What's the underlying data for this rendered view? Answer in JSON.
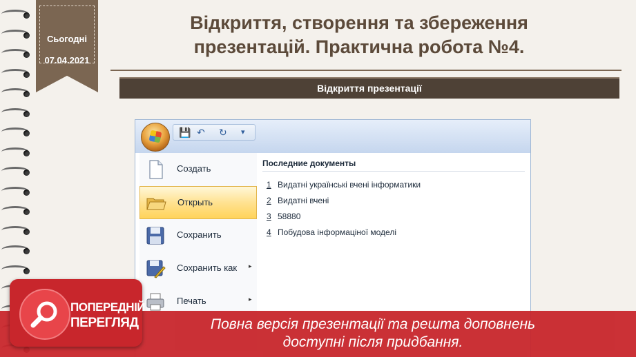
{
  "date_ribbon": {
    "label": "Сьогодні",
    "date": "07.04.2021"
  },
  "slide": {
    "title": "Відкриття, створення та збереження презентацій. Практична робота №4.",
    "section_heading": "Відкриття презентації"
  },
  "office_menu": {
    "items": [
      {
        "label": "Создать",
        "icon": "new-document-icon",
        "submenu": false,
        "active": false
      },
      {
        "label": "Открыть",
        "icon": "open-folder-icon",
        "submenu": false,
        "active": true
      },
      {
        "label": "Сохранить",
        "icon": "save-disk-icon",
        "submenu": false,
        "active": false
      },
      {
        "label": "Сохранить как",
        "icon": "save-as-icon",
        "submenu": true,
        "active": false
      },
      {
        "label": "Печать",
        "icon": "printer-icon",
        "submenu": true,
        "active": false
      }
    ],
    "submenu_arrow": "▸",
    "recent_title": "Последние документы",
    "recent": [
      {
        "num": "1",
        "name": "Видатні українські вчені інформатики"
      },
      {
        "num": "2",
        "name": "Видатні вчені"
      },
      {
        "num": "3",
        "name": "58880"
      },
      {
        "num": "4",
        "name": "Побудова інформаціної моделі"
      }
    ],
    "quick_access": {
      "save": "💾",
      "undo": "↶",
      "redo": "↻",
      "more": "▾"
    }
  },
  "preview": {
    "badge_line1": "ПОПЕРЕДНІЙ",
    "badge_line2": "ПЕРЕГЛЯД",
    "banner_text": "Повна версія презентації та решта доповнень доступні після придбання."
  },
  "colors": {
    "brown": "#7b6652",
    "dark_brown": "#4e4136",
    "title": "#5c4a3a",
    "red": "#c8262c",
    "highlight": "#ffd35a"
  }
}
